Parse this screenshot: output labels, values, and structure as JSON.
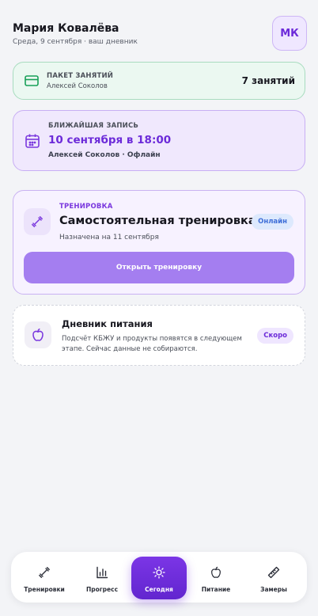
{
  "header": {
    "user_name": "Мария Ковалёва",
    "subtitle": "Среда, 9 сентября · ваш дневник",
    "avatar_initials": "МК"
  },
  "package": {
    "label": "ПАКЕТ ЗАНЯТИЙ",
    "trainer": "Алексей Соколов",
    "count": "7 занятий",
    "icon": "credit-card-icon"
  },
  "next_session": {
    "label": "БЛИЖАЙШАЯ ЗАПИСЬ",
    "datetime": "10 сентября в 18:00",
    "meta": "Алексей Соколов · Офлайн",
    "icon": "calendar-icon"
  },
  "workout": {
    "category": "ТРЕНИРОВКА",
    "title": "Самостоятельная тренировка",
    "assigned": "Назначена на 11 сентября",
    "badge": "Онлайн",
    "button_label": "Открыть тренировку",
    "icon": "dumbbell-icon"
  },
  "nutrition": {
    "title": "Дневник питания",
    "description": "Подсчёт КБЖУ и продукты появятся в следующем этапе. Сейчас данные не собираются.",
    "badge": "Скоро",
    "icon": "apple-icon"
  },
  "nav": {
    "items": [
      {
        "label": "Тренировки",
        "icon": "dumbbell-icon"
      },
      {
        "label": "Прогресс",
        "icon": "bar-chart-icon"
      },
      {
        "label": "Сегодня",
        "icon": "sun-icon",
        "active": true
      },
      {
        "label": "Питание",
        "icon": "apple-icon"
      },
      {
        "label": "Замеры",
        "icon": "ruler-icon"
      }
    ]
  },
  "colors": {
    "accent": "#6c2bd9",
    "background": "#f3f4f7",
    "package_bg": "#ebf8f1",
    "next_session_bg": "#f0e8fd",
    "online_badge": "#3f6fd8",
    "button": "#a47ef0"
  }
}
